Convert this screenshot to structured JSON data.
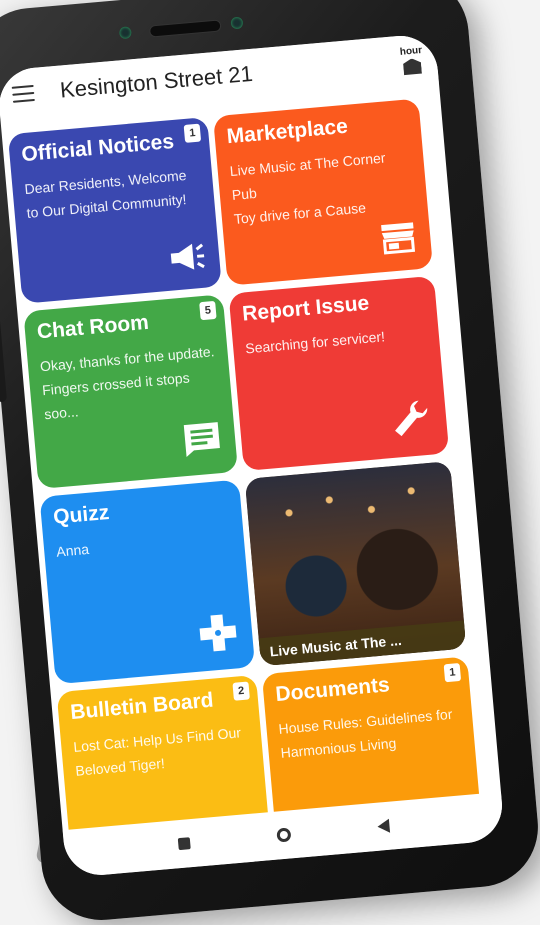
{
  "app": {
    "title": "Kesington Street 21",
    "hour_label": "hour"
  },
  "tiles": {
    "notices": {
      "title": "Official Notices",
      "badge": "1",
      "text": "Dear Residents, Welcome to Our Digital Community!",
      "icon": "megaphone-icon",
      "color": "#3a48b0"
    },
    "marketplace": {
      "title": "Marketplace",
      "line1": "Live Music at The Corner Pub",
      "line2": "Toy drive for a Cause",
      "icon": "storefront-icon",
      "color": "#fb5a1e"
    },
    "chat": {
      "title": "Chat Room",
      "badge": "5",
      "text": "Okay, thanks for the update. Fingers crossed it stops soo...",
      "icon": "chat-icon",
      "color": "#43a847"
    },
    "report": {
      "title": "Report Issue",
      "text": "Searching for servicer!",
      "icon": "wrench-icon",
      "color": "#ef3b36"
    },
    "quizz": {
      "title": "Quizz",
      "text": "Anna",
      "icon": "gamepad-icon",
      "color": "#1e8ef0"
    },
    "photo": {
      "caption": "Live Music at The ..."
    },
    "bulletin": {
      "title": "Bulletin Board",
      "badge": "2",
      "text": "Lost Cat: Help Us Find Our Beloved Tiger!",
      "color": "#fbbd14"
    },
    "documents": {
      "title": "Documents",
      "badge": "1",
      "text": "House Rules: Guidelines for Harmonious Living",
      "color": "#fb9b0a"
    }
  },
  "navigation": {
    "items": [
      "recents-button",
      "home-button",
      "back-button"
    ]
  }
}
